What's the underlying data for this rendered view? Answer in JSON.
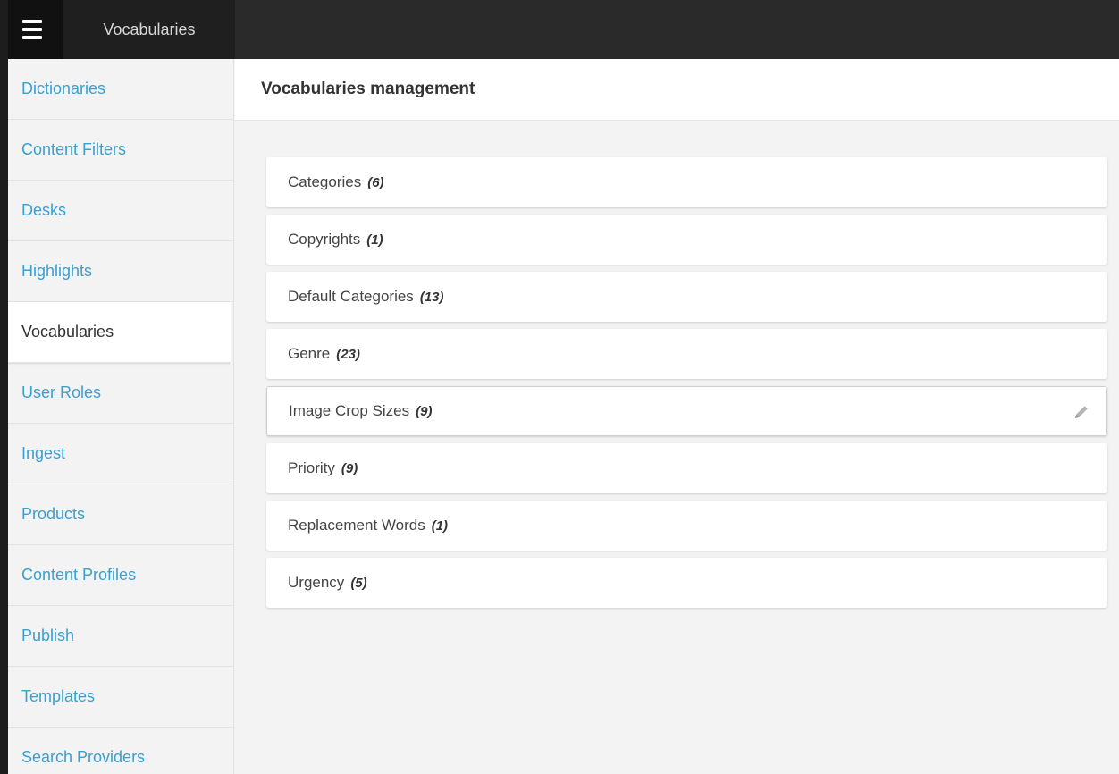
{
  "app": {
    "title": "Vocabularies"
  },
  "icons": {
    "menu": "hamburger-icon",
    "edit": "pencil-icon"
  },
  "sidebar": {
    "items": [
      {
        "label": "Dictionaries",
        "active": false
      },
      {
        "label": "Content Filters",
        "active": false
      },
      {
        "label": "Desks",
        "active": false
      },
      {
        "label": "Highlights",
        "active": false
      },
      {
        "label": "Vocabularies",
        "active": true
      },
      {
        "label": "User Roles",
        "active": false
      },
      {
        "label": "Ingest",
        "active": false
      },
      {
        "label": "Products",
        "active": false
      },
      {
        "label": "Content Profiles",
        "active": false
      },
      {
        "label": "Publish",
        "active": false
      },
      {
        "label": "Templates",
        "active": false
      },
      {
        "label": "Search Providers",
        "active": false
      }
    ]
  },
  "main": {
    "title": "Vocabularies management",
    "vocabularies": [
      {
        "name": "Categories",
        "count": "(6)"
      },
      {
        "name": "Copyrights",
        "count": "(1)"
      },
      {
        "name": "Default Categories",
        "count": "(13)"
      },
      {
        "name": "Genre",
        "count": "(23)"
      },
      {
        "name": "Image Crop Sizes",
        "count": "(9)",
        "hovered": true
      },
      {
        "name": "Priority",
        "count": "(9)"
      },
      {
        "name": "Replacement Words",
        "count": "(1)"
      },
      {
        "name": "Urgency",
        "count": "(5)"
      }
    ]
  },
  "colors": {
    "link": "#3a9fd1",
    "topbar": "#2a2a2a",
    "active_text": "#333333"
  }
}
